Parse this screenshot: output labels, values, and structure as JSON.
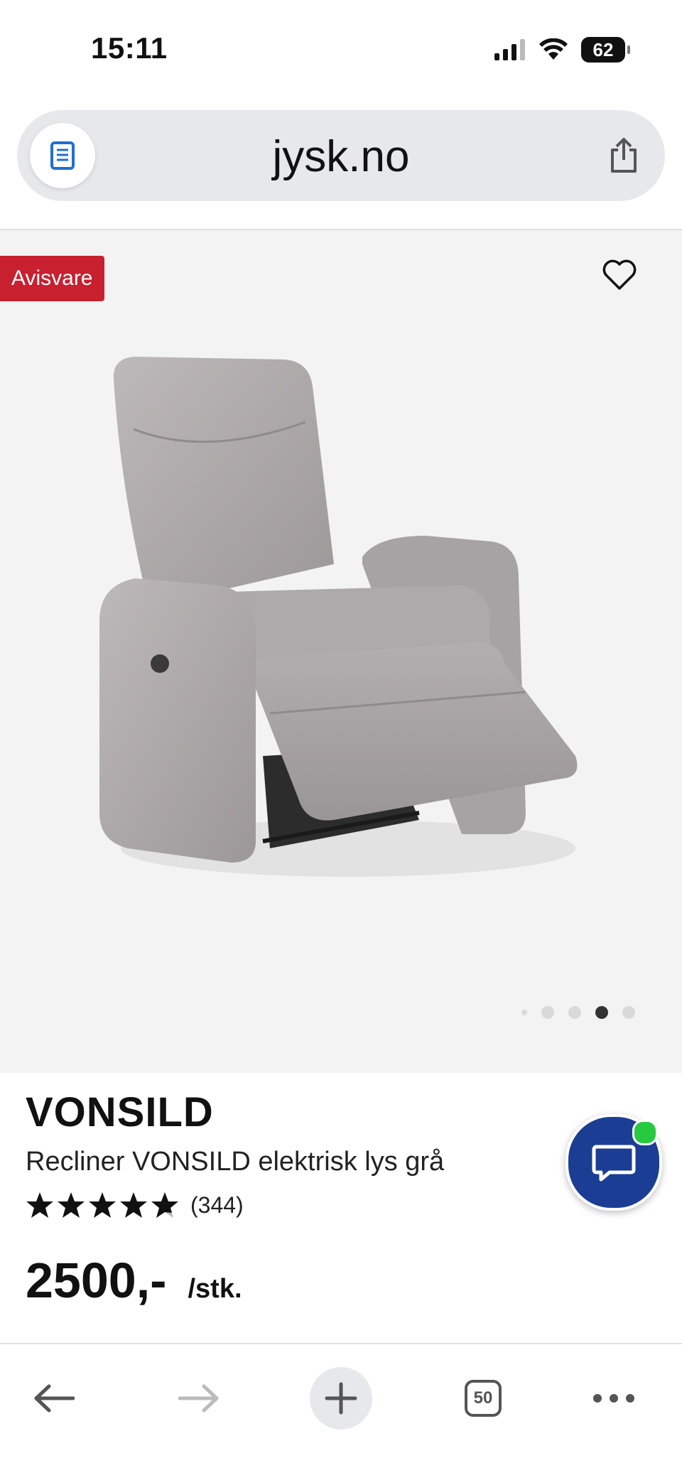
{
  "status": {
    "time": "15:11",
    "battery": "62"
  },
  "browser": {
    "url": "jysk.no",
    "tab_count": "50"
  },
  "product": {
    "badge": "Avisvare",
    "brand": "VONSILD",
    "name": "Recliner VONSILD elektrisk lys grå",
    "rating": 4.5,
    "review_count": "(344)",
    "price": "2500,-",
    "unit": "/stk.",
    "gallery_total": 5,
    "gallery_active_index": 3
  },
  "colors": {
    "badge": "#c8202f",
    "chat": "#1b3e94",
    "online": "#27c93f"
  },
  "icons": [
    "reader-icon",
    "share-icon",
    "heart-icon",
    "chat-icon",
    "back-arrow-icon",
    "forward-arrow-icon",
    "plus-icon",
    "tabs-icon",
    "more-icon"
  ]
}
